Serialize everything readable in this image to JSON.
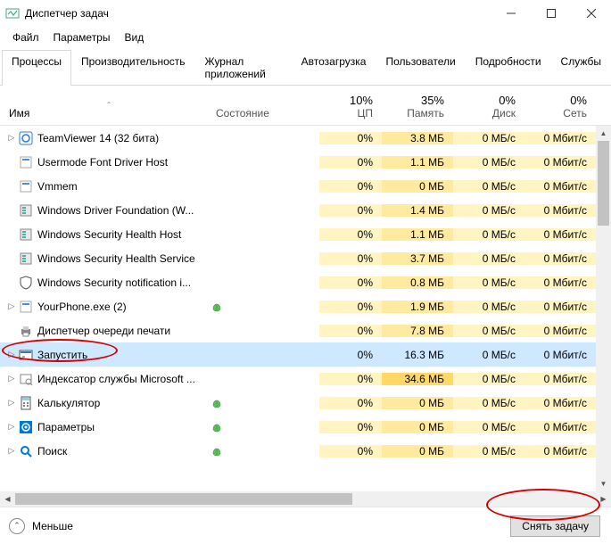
{
  "window": {
    "title": "Диспетчер задач"
  },
  "menu": {
    "file": "Файл",
    "options": "Параметры",
    "view": "Вид"
  },
  "tabs": {
    "processes": "Процессы",
    "performance": "Производительность",
    "app_history": "Журнал приложений",
    "startup": "Автозагрузка",
    "users": "Пользователи",
    "details": "Подробности",
    "services": "Службы"
  },
  "columns": {
    "name": "Имя",
    "state": "Состояние",
    "cpu_pct": "10%",
    "cpu_lbl": "ЦП",
    "mem_pct": "35%",
    "mem_lbl": "Память",
    "disk_pct": "0%",
    "disk_lbl": "Диск",
    "net_pct": "0%",
    "net_lbl": "Сеть"
  },
  "rows": [
    {
      "exp": true,
      "icon": "tv",
      "name": "TeamViewer 14 (32 бита)",
      "leaf": false,
      "cpu": "0%",
      "mem": "3.8 МБ",
      "disk": "0 МБ/с",
      "net": "0 Мбит/с",
      "memhi": false
    },
    {
      "exp": false,
      "icon": "app",
      "name": "Usermode Font Driver Host",
      "leaf": false,
      "cpu": "0%",
      "mem": "1.1 МБ",
      "disk": "0 МБ/с",
      "net": "0 Мбит/с",
      "memhi": false
    },
    {
      "exp": false,
      "icon": "app",
      "name": "Vmmem",
      "leaf": false,
      "cpu": "0%",
      "mem": "0 МБ",
      "disk": "0 МБ/с",
      "net": "0 Мбит/с",
      "memhi": false
    },
    {
      "exp": false,
      "icon": "svc",
      "name": "Windows Driver Foundation (W...",
      "leaf": false,
      "cpu": "0%",
      "mem": "1.4 МБ",
      "disk": "0 МБ/с",
      "net": "0 Мбит/с",
      "memhi": false
    },
    {
      "exp": false,
      "icon": "svc",
      "name": "Windows Security Health Host",
      "leaf": false,
      "cpu": "0%",
      "mem": "1.1 МБ",
      "disk": "0 МБ/с",
      "net": "0 Мбит/с",
      "memhi": false
    },
    {
      "exp": false,
      "icon": "svc",
      "name": "Windows Security Health Service",
      "leaf": false,
      "cpu": "0%",
      "mem": "3.7 МБ",
      "disk": "0 МБ/с",
      "net": "0 Мбит/с",
      "memhi": false
    },
    {
      "exp": false,
      "icon": "shield",
      "name": "Windows Security notification i...",
      "leaf": false,
      "cpu": "0%",
      "mem": "0.8 МБ",
      "disk": "0 МБ/с",
      "net": "0 Мбит/с",
      "memhi": false
    },
    {
      "exp": true,
      "icon": "app",
      "name": "YourPhone.exe (2)",
      "leaf": true,
      "cpu": "0%",
      "mem": "1.9 МБ",
      "disk": "0 МБ/с",
      "net": "0 Мбит/с",
      "memhi": false
    },
    {
      "exp": false,
      "icon": "printer",
      "name": "Диспетчер очереди печати",
      "leaf": false,
      "cpu": "0%",
      "mem": "7.8 МБ",
      "disk": "0 МБ/с",
      "net": "0 Мбит/с",
      "memhi": false
    },
    {
      "exp": true,
      "icon": "run",
      "name": "Запустить",
      "leaf": false,
      "cpu": "0%",
      "mem": "16.3 МБ",
      "disk": "0 МБ/с",
      "net": "0 Мбит/с",
      "memhi": false,
      "selected": true
    },
    {
      "exp": true,
      "icon": "index",
      "name": "Индексатор службы Microsoft ...",
      "leaf": false,
      "cpu": "0%",
      "mem": "34.6 МБ",
      "disk": "0 МБ/с",
      "net": "0 Мбит/с",
      "memhi": true
    },
    {
      "exp": true,
      "icon": "calc",
      "name": "Калькулятор",
      "leaf": true,
      "cpu": "0%",
      "mem": "0 МБ",
      "disk": "0 МБ/с",
      "net": "0 Мбит/с",
      "memhi": false
    },
    {
      "exp": true,
      "icon": "settings",
      "name": "Параметры",
      "leaf": true,
      "cpu": "0%",
      "mem": "0 МБ",
      "disk": "0 МБ/с",
      "net": "0 Мбит/с",
      "memhi": false
    },
    {
      "exp": true,
      "icon": "search",
      "name": "Поиск",
      "leaf": true,
      "cpu": "0%",
      "mem": "0 МБ",
      "disk": "0 МБ/с",
      "net": "0 Мбит/с",
      "memhi": false
    }
  ],
  "footer": {
    "fewer": "Меньше",
    "end_task": "Снять задачу"
  }
}
